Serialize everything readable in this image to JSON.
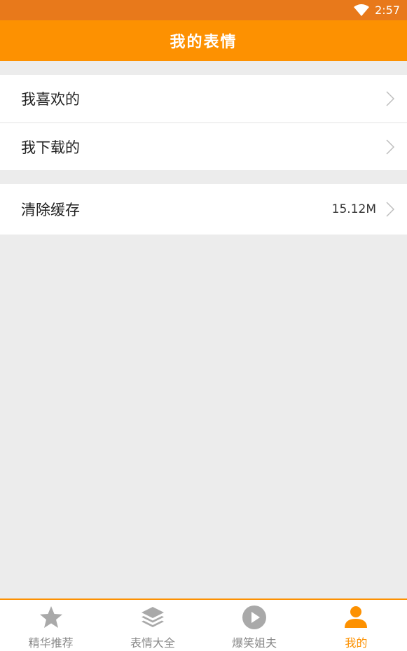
{
  "status_bar": {
    "time": "2:57"
  },
  "header": {
    "title": "我的表情"
  },
  "menu": {
    "group1": [
      {
        "label": "我喜欢的"
      },
      {
        "label": "我下载的"
      }
    ],
    "group2": [
      {
        "label": "清除缓存",
        "value": "15.12M"
      }
    ]
  },
  "tabs": [
    {
      "label": "精华推荐",
      "icon": "star-icon"
    },
    {
      "label": "表情大全",
      "icon": "layers-icon"
    },
    {
      "label": "爆笑姐夫",
      "icon": "play-icon"
    },
    {
      "label": "我的",
      "icon": "user-icon",
      "active": true
    }
  ],
  "colors": {
    "status_bar": "#e8791b",
    "header": "#fd9101",
    "active_tab": "#fd9101",
    "inactive_tab": "#8a8a8a",
    "background": "#ececec"
  }
}
